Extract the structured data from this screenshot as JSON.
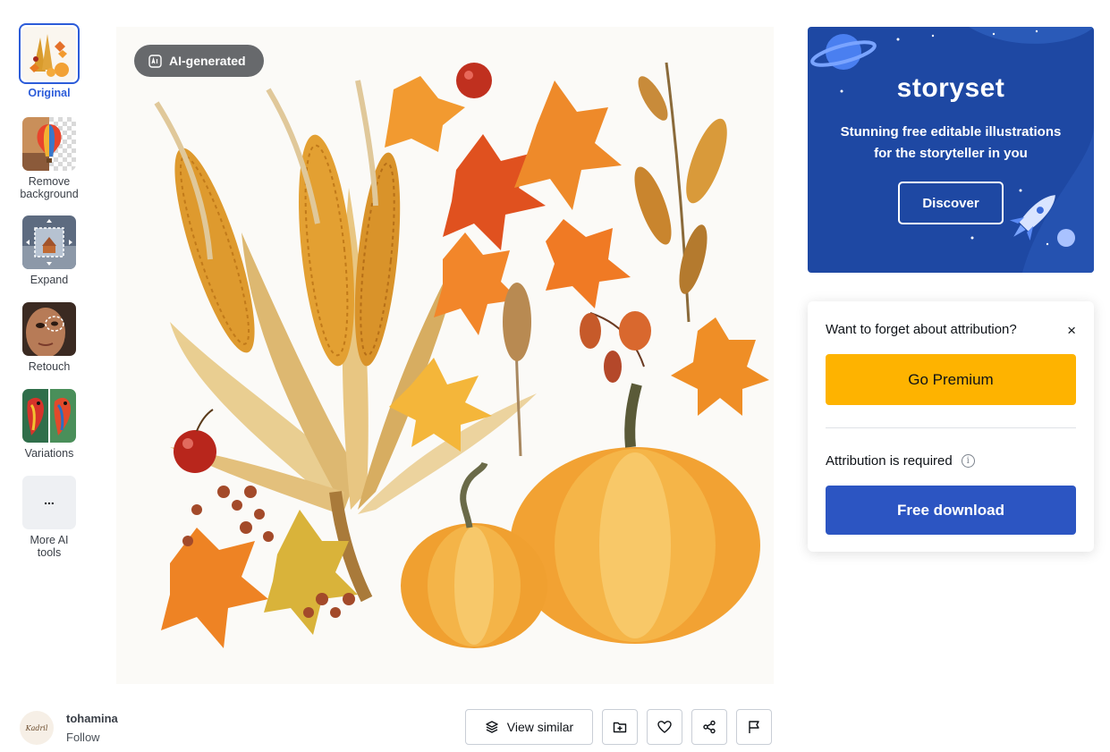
{
  "tools": [
    {
      "label": "Original",
      "icon": "original-thumbnail",
      "active": true
    },
    {
      "label": "Remove background",
      "icon": "remove-background-thumbnail"
    },
    {
      "label": "Expand",
      "icon": "expand-thumbnail"
    },
    {
      "label": "Retouch",
      "icon": "retouch-thumbnail"
    },
    {
      "label": "Variations",
      "icon": "variations-thumbnail"
    },
    {
      "label": "More AI tools",
      "icon": "more-icon",
      "glyph": "..."
    }
  ],
  "image": {
    "badge": "AI-generated",
    "badge_icon": "ai-icon"
  },
  "author": {
    "name": "tohamina",
    "follow": "Follow",
    "avatar_text": "Kadril"
  },
  "actions": {
    "view_similar": "View similar",
    "icons": [
      "add-to-collection-icon",
      "heart-icon",
      "share-icon",
      "flag-icon"
    ]
  },
  "ad": {
    "logo": "storyset",
    "tagline_line1": "Stunning free editable illustrations",
    "tagline_line2": "for the storyteller in you",
    "cta": "Discover",
    "bg_color": "#1e48a3"
  },
  "download": {
    "question": "Want to forget about attribution?",
    "close": "×",
    "premium": "Go Premium",
    "attribution": "Attribution is required",
    "info_glyph": "i",
    "free": "Free download",
    "premium_color": "#feb300",
    "free_color": "#2c55c2"
  }
}
